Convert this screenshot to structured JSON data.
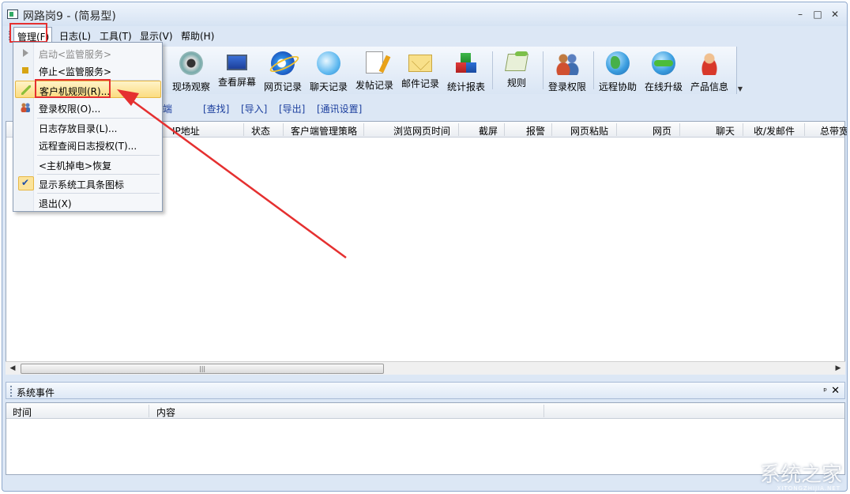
{
  "window": {
    "title": "网路岗9 - (简易型)",
    "controls": {
      "minimize": "–",
      "maximize": "□",
      "close": "✕"
    }
  },
  "menubar": {
    "items": [
      "管理(F)",
      "日志(L)",
      "工具(T)",
      "显示(V)",
      "帮助(H)"
    ],
    "active": "管理(F)"
  },
  "management_menu": {
    "items": [
      {
        "label": "启动<监管服务>",
        "disabled": true,
        "icon": "play-icon"
      },
      {
        "label": "停止<监管服务>",
        "icon": "stop-icon"
      },
      {
        "label": "客户机规则(R)...",
        "highlighted": true,
        "icon": "rule-icon"
      },
      {
        "label": "登录权限(O)...",
        "icon": "users-icon"
      },
      {
        "label": "日志存放目录(L)..."
      },
      {
        "label": "远程查阅日志授权(T)..."
      },
      {
        "label": "<主机掉电>恢复"
      },
      {
        "label": "显示系统工具条图标",
        "checked": true,
        "icon": "check-icon"
      },
      {
        "label": "退出(X)"
      }
    ]
  },
  "toolbar": {
    "buttons": [
      {
        "label": "现场观察",
        "icon": "eye-icon"
      },
      {
        "label": "查看屏幕",
        "icon": "monitor-icon"
      },
      {
        "label": "网页记录",
        "icon": "ie-icon"
      },
      {
        "label": "聊天记录",
        "icon": "chat-bubble-icon"
      },
      {
        "label": "发帖记录",
        "icon": "post-note-icon"
      },
      {
        "label": "邮件记录",
        "icon": "envelope-icon"
      },
      {
        "label": "统计报表",
        "icon": "cubes-icon"
      },
      {
        "label": "规则",
        "icon": "rule-icon"
      },
      {
        "label": "登录权限",
        "icon": "users-icon"
      },
      {
        "label": "远程协助",
        "icon": "globe-icon"
      },
      {
        "label": "在线升级",
        "icon": "globe-arrow-icon"
      },
      {
        "label": "产品信息",
        "icon": "mascot-icon"
      }
    ]
  },
  "linkbar": {
    "fragment": "端",
    "links": [
      "[查找]",
      "[导入]",
      "[导出]",
      "[通讯设置]"
    ]
  },
  "client_table": {
    "columns": [
      "IP地址",
      "状态",
      "客户端管理策略",
      "浏览网页时间",
      "截屏",
      "报警",
      "网页粘贴",
      "网页",
      "聊天",
      "收/发邮件",
      "总带宽"
    ]
  },
  "scrollbar": {
    "left_arrow": "◀",
    "right_arrow": "▶",
    "grip": "|||"
  },
  "events_pane": {
    "title": "系统事件",
    "pin": "ᵖ",
    "close": "✕",
    "columns": [
      "时间",
      "内容"
    ]
  },
  "watermark": {
    "text": "系统之家",
    "sub": "XITONGZHIJIA.NET"
  },
  "colors": {
    "highlight_box": "#e53030",
    "menu_highlight": "#fbdc80",
    "link": "#1c3f9e"
  }
}
